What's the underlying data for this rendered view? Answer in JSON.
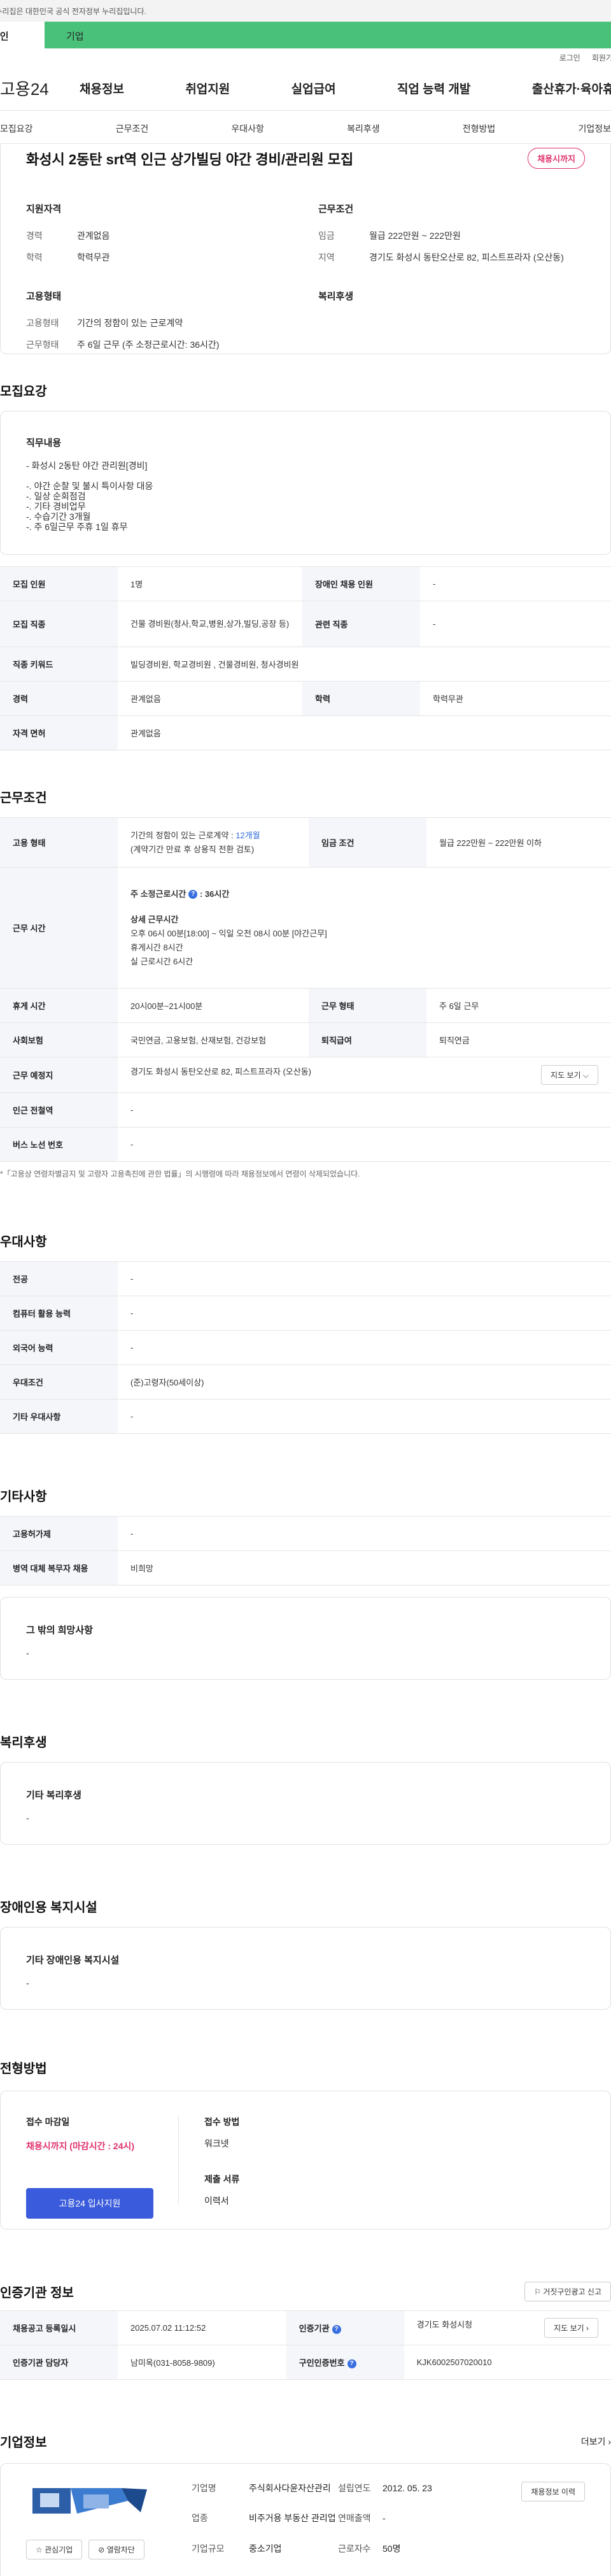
{
  "banner": {
    "text": "이 누리집은 대한민국 공식 전자정부 누리집입니다."
  },
  "user_tabs": {
    "person": "개인",
    "corp": "기업"
  },
  "top_links": {
    "login": "로그인",
    "join": "회원가입"
  },
  "gnb": {
    "logo": "고용24",
    "menu": [
      "채용정보",
      "취업지원",
      "실업급여",
      "직업 능력 개발",
      "출산휴가·육아휴직"
    ]
  },
  "anchors": [
    "모집요강",
    "근무조건",
    "우대사항",
    "복리후생",
    "전형방법",
    "기업정보"
  ],
  "job": {
    "title": "화성시 2동탄 srt역 인근 상가빌딩 야간 경비/관리원 모집",
    "status": "채용시까지"
  },
  "summary": {
    "qual_title": "지원자격",
    "qual": [
      {
        "k": "경력",
        "v": "관계없음"
      },
      {
        "k": "학력",
        "v": "학력무관"
      }
    ],
    "cond_title": "근무조건",
    "cond": [
      {
        "k": "임금",
        "v": "월급 222만원 ~ 222만원"
      },
      {
        "k": "지역",
        "v": "경기도 화성시 동탄오산로 82, 피스트프라자 (오산동)"
      }
    ],
    "emp_title": "고용형태",
    "emp": [
      {
        "k": "고용형태",
        "v": "기간의 정함이 있는 근로계약"
      },
      {
        "k": "근무형태",
        "v": "주 6일 근무 (주 소정근로시간: 36시간)"
      }
    ],
    "welfare_title": "복리후생"
  },
  "recruit": {
    "title": "모집요강",
    "intro_title": "직무내용",
    "intro_lines": [
      "- 화성시 2동탄 야간 관리원[경비]",
      "",
      "-. 야간 순찰 및 불시 특이사항 대응",
      "-. 일상 순회점검",
      "-. 기타 경비업무",
      "-. 수습기간 3개월",
      "-. 주 6일근무 주휴 1일 휴무"
    ],
    "rows": [
      {
        "k1": "모집 인원",
        "v1": "1명",
        "k2": "장애인 채용 인원",
        "v2": "-"
      },
      {
        "k1": "모집 직종",
        "v1": "건물 경비원(청사,학교,병원,상가,빌딩,공장 등)",
        "k2": "관련 직종",
        "v2": "-"
      },
      {
        "k1": "직종 키워드",
        "v1": "빌딩경비원, 학교경비원 , 건물경비원, 청사경비원"
      },
      {
        "k1": "경력",
        "v1": "관계없음",
        "k2": "학력",
        "v2": "학력무관"
      },
      {
        "k1": "자격 면허",
        "v1": "관계없음"
      }
    ]
  },
  "work": {
    "title": "근무조건",
    "emp_type_k": "고용 형태",
    "emp_type_v1": "기간의 정함이 있는 근로계약 : ",
    "emp_type_link": "12개월",
    "emp_type_v2": "(계약기간 만료 후 상용직 전환 검토)",
    "wage_k": "임금 조건",
    "wage_v": "월급 222만원 ~ 222만원 이하",
    "time_k": "근무 시간",
    "time_week": "주 소정근로시간",
    "time_week_v": ": 36시간",
    "time_detail_title": "상세 근무시간",
    "time_detail": [
      "오후 06시 00분[18:00] ~ 익일 오전 08시 00분  [야간근무]",
      "휴게시간 8시간",
      "실 근로시간 6시간"
    ],
    "rest_k": "휴게 시간",
    "rest_v": "20시00분~21시00분",
    "form_k": "근무 형태",
    "form_v": "주 6일 근무",
    "ins_k": "사회보험",
    "ins_v": "국민연금, 고용보험, 산재보험, 건강보험",
    "ret_k": "퇴직급여",
    "ret_v": "퇴직연금",
    "place_k": "근무 예정지",
    "place_v": "경기도 화성시 동탄오산로 82, 피스트프라자 (오산동)",
    "map_btn": "지도 보기",
    "subway_k": "인근 전철역",
    "subway_v": "-",
    "bus_k": "버스 노선 번호",
    "bus_v": "-",
    "note": "*「고용상 연령차별금지 및 고령자 고용촉진에 관한 법률」의 시행령에 따라 채용정보에서 연령이 삭제되었습니다."
  },
  "pref": {
    "title": "우대사항",
    "rows": [
      {
        "k": "전공",
        "v": "-"
      },
      {
        "k": "컴퓨터 활용 능력",
        "v": "-"
      },
      {
        "k": "외국어 능력",
        "v": "-"
      },
      {
        "k": "우대조건",
        "v": "(준)고령자(50세이상)"
      },
      {
        "k": "기타 우대사항",
        "v": "-"
      }
    ]
  },
  "etc": {
    "title": "기타사항",
    "rows": [
      {
        "k": "고용허가제",
        "v": "-"
      },
      {
        "k": "병역 대체 복무자 채용",
        "v": "비희망"
      }
    ],
    "other_title": "그 밖의 희망사항",
    "other_v": "-"
  },
  "welfare": {
    "title": "복리후생",
    "box_title": "기타 복리후생",
    "box_v": "-"
  },
  "disabled": {
    "title": "장애인용 복지시설",
    "box_title": "기타 장애인용 복지시설",
    "box_v": "-"
  },
  "selection": {
    "title": "전형방법",
    "deadline_t": "접수 마감일",
    "deadline_v": "채용시까지 (마감시간 : 24시)",
    "apply_btn": "고용24 입사지원",
    "method_t": "접수 방법",
    "method_v": "워크넷",
    "docs_t": "제출 서류",
    "docs_v": "이력서"
  },
  "cert": {
    "title": "인증기관 정보",
    "report_btn": "거짓구인광고 신고",
    "reg_k": "채용공고 등록일시",
    "reg_v": "2025.07.02 11:12:52",
    "org_k": "인증기관",
    "org_v": "경기도 화성시청",
    "map_btn": "지도 보기",
    "mgr_k": "인증기관 담당자",
    "mgr_v": "남미옥(031-8058-9809)",
    "no_k": "구인인증번호",
    "no_v": "KJK6002507020010"
  },
  "company": {
    "title": "기업정보",
    "more": "더보기",
    "fav_btn": "관심기업",
    "block_btn": "열람차단",
    "name_k": "기업명",
    "name_v": "주식회사다윤자산관리",
    "found_k": "설립연도",
    "found_v": "2012. 05. 23",
    "biz_k": "업종",
    "biz_v": "비주거용 부동산 관리업",
    "sales_k": "연매출액",
    "sales_v": "-",
    "size_k": "기업규모",
    "size_v": "중소기업",
    "emp_k": "근로자수",
    "emp_v": "50명",
    "resume_btn": "채용정보 이력"
  }
}
